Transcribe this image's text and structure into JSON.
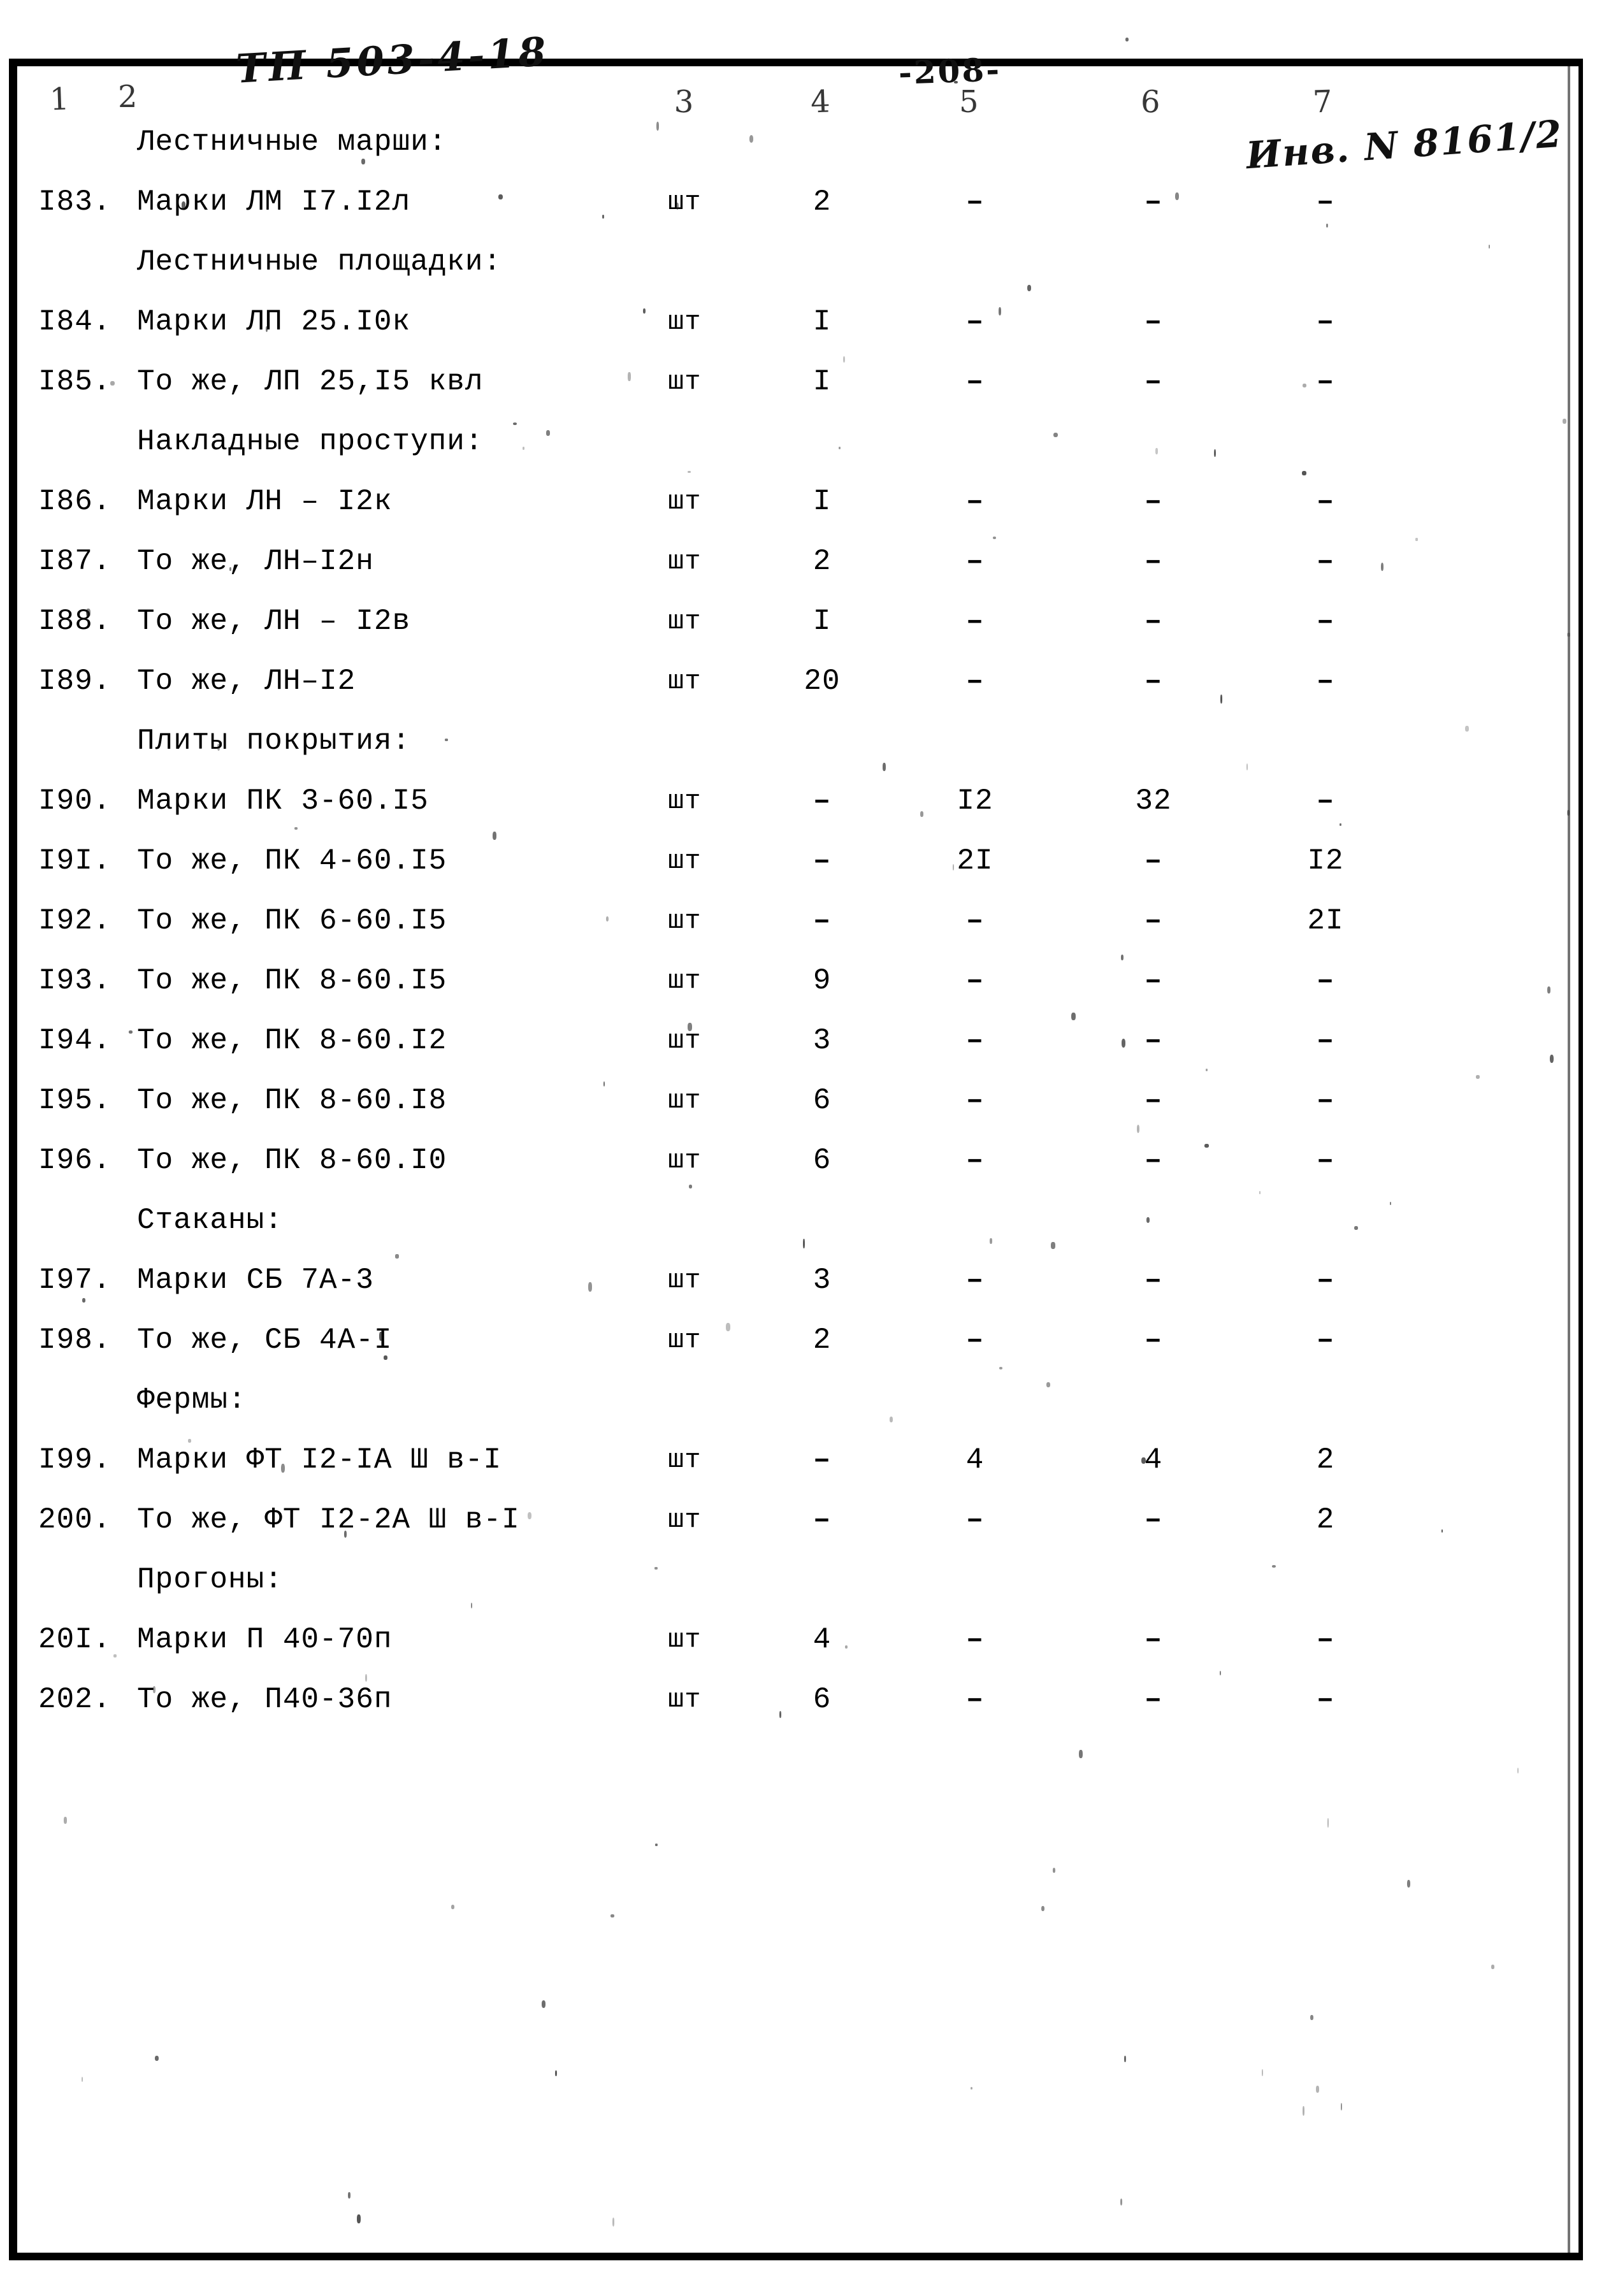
{
  "document": {
    "code": "ТП 503-4-18",
    "page_number": "-208-",
    "inventory_stamp": "Инв. N 8161/2"
  },
  "table": {
    "column_numbers": [
      "1",
      "2",
      "3",
      "4",
      "5",
      "6",
      "7"
    ],
    "unit_piece": "шт",
    "dash": "–",
    "rows": [
      {
        "type": "group",
        "label": "Лестничные марши:"
      },
      {
        "type": "item",
        "num": "I83.",
        "name": "Марки ЛМ I7.I2л",
        "unit": "шт",
        "q4": "2",
        "q5": "–",
        "q6": "–",
        "q7": "–"
      },
      {
        "type": "group",
        "label": "Лестничные площадки:"
      },
      {
        "type": "item",
        "num": "I84.",
        "name": "Марки ЛП 25.I0к",
        "unit": "шт",
        "q4": "I",
        "q5": "–",
        "q6": "–",
        "q7": "–"
      },
      {
        "type": "item",
        "num": "I85.",
        "name": "То же, ЛП 25,I5 квл",
        "unit": "шт",
        "q4": "I",
        "q5": "–",
        "q6": "–",
        "q7": "–"
      },
      {
        "type": "group",
        "label": "Накладные проступи:"
      },
      {
        "type": "item",
        "num": "I86.",
        "name": "Марки ЛН – I2к",
        "unit": "шт",
        "q4": "I",
        "q5": "–",
        "q6": "–",
        "q7": "–"
      },
      {
        "type": "item",
        "num": "I87.",
        "name": "То же, ЛН–I2н",
        "unit": "шт",
        "q4": "2",
        "q5": "–",
        "q6": "–",
        "q7": "–"
      },
      {
        "type": "item",
        "num": "I88.",
        "name": "То же, ЛН – I2в",
        "unit": "шт",
        "q4": "I",
        "q5": "–",
        "q6": "–",
        "q7": "–"
      },
      {
        "type": "item",
        "num": "I89.",
        "name": "То же, ЛН–I2",
        "unit": "шт",
        "q4": "20",
        "q5": "–",
        "q6": "–",
        "q7": "–"
      },
      {
        "type": "group",
        "label": "Плиты покрытия:"
      },
      {
        "type": "item",
        "num": "I90.",
        "name": "Марки ПК 3-60.I5",
        "unit": "шт",
        "q4": "–",
        "q5": "I2",
        "q6": "32",
        "q7": "–"
      },
      {
        "type": "item",
        "num": "I9I.",
        "name": "То же, ПК 4-60.I5",
        "unit": "шт",
        "q4": "–",
        "q5": "2I",
        "q6": "–",
        "q7": "I2"
      },
      {
        "type": "item",
        "num": "I92.",
        "name": "То же, ПК 6-60.I5",
        "unit": "шт",
        "q4": "–",
        "q5": "–",
        "q6": "–",
        "q7": "2I"
      },
      {
        "type": "item",
        "num": "I93.",
        "name": "То же, ПК 8-60.I5",
        "unit": "шт",
        "q4": "9",
        "q5": "–",
        "q6": "–",
        "q7": "–"
      },
      {
        "type": "item",
        "num": "I94.",
        "name": "То же, ПК 8-60.I2",
        "unit": "шт",
        "q4": "3",
        "q5": "–",
        "q6": "–",
        "q7": "–"
      },
      {
        "type": "item",
        "num": "I95.",
        "name": "То же, ПК 8-60.I8",
        "unit": "шт",
        "q4": "6",
        "q5": "–",
        "q6": "–",
        "q7": "–"
      },
      {
        "type": "item",
        "num": "I96.",
        "name": "То же, ПК 8-60.I0",
        "unit": "шт",
        "q4": "6",
        "q5": "–",
        "q6": "–",
        "q7": "–"
      },
      {
        "type": "group",
        "label": "Стаканы:"
      },
      {
        "type": "item",
        "num": "I97.",
        "name": "Марки СБ 7А-3",
        "unit": "шт",
        "q4": "3",
        "q5": "–",
        "q6": "–",
        "q7": "–"
      },
      {
        "type": "item",
        "num": "I98.",
        "name": "То же, СБ 4А-I",
        "unit": "шт",
        "q4": "2",
        "q5": "–",
        "q6": "–",
        "q7": "–"
      },
      {
        "type": "group",
        "label": "Фермы:"
      },
      {
        "type": "item",
        "num": "I99.",
        "name": "Марки ФТ I2-IА Ш в-I",
        "unit": "шт",
        "q4": "–",
        "q5": "4",
        "q6": "4",
        "q7": "2"
      },
      {
        "type": "item",
        "num": "200.",
        "name": "То же, ФТ I2-2А Ш в-I",
        "unit": "шт",
        "q4": "–",
        "q5": "–",
        "q6": "–",
        "q7": "2"
      },
      {
        "type": "group",
        "label": "Прогоны:"
      },
      {
        "type": "item",
        "num": "20I.",
        "name": "Марки П 40-70п",
        "unit": "шт",
        "q4": "4",
        "q5": "–",
        "q6": "–",
        "q7": "–"
      },
      {
        "type": "item",
        "num": "202.",
        "name": "То же, П40-36п",
        "unit": "шт",
        "q4": "6",
        "q5": "–",
        "q6": "–",
        "q7": "–"
      }
    ]
  }
}
